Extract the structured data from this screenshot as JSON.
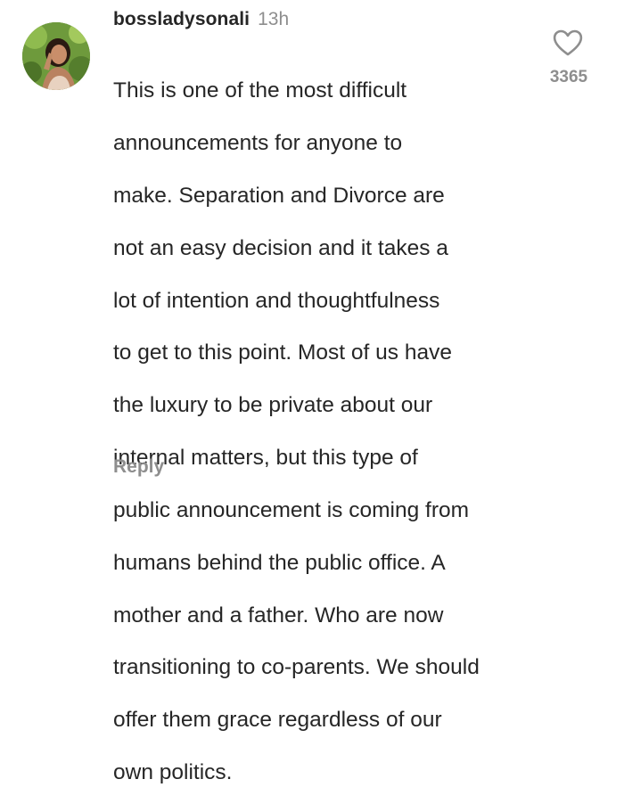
{
  "comment": {
    "username": "bossladysonali",
    "time": "13h",
    "text_lines": [
      "This is one of the most difficult",
      "announcements for anyone to",
      "make.  Separation and Divorce are",
      "not an easy decision and it takes a",
      "lot of intention and thoughtfulness",
      "to get to this point. Most of us have",
      "the luxury to be private about our",
      "internal matters, but this type of",
      "public announcement is coming from",
      "humans behind the public office. A",
      "mother and a father. Who are now",
      "transitioning to co-parents. We should",
      "offer them grace regardless of our",
      "own politics."
    ],
    "reply_label": "Reply",
    "like_count": "3365",
    "like_icon": "heart-outline-icon"
  }
}
